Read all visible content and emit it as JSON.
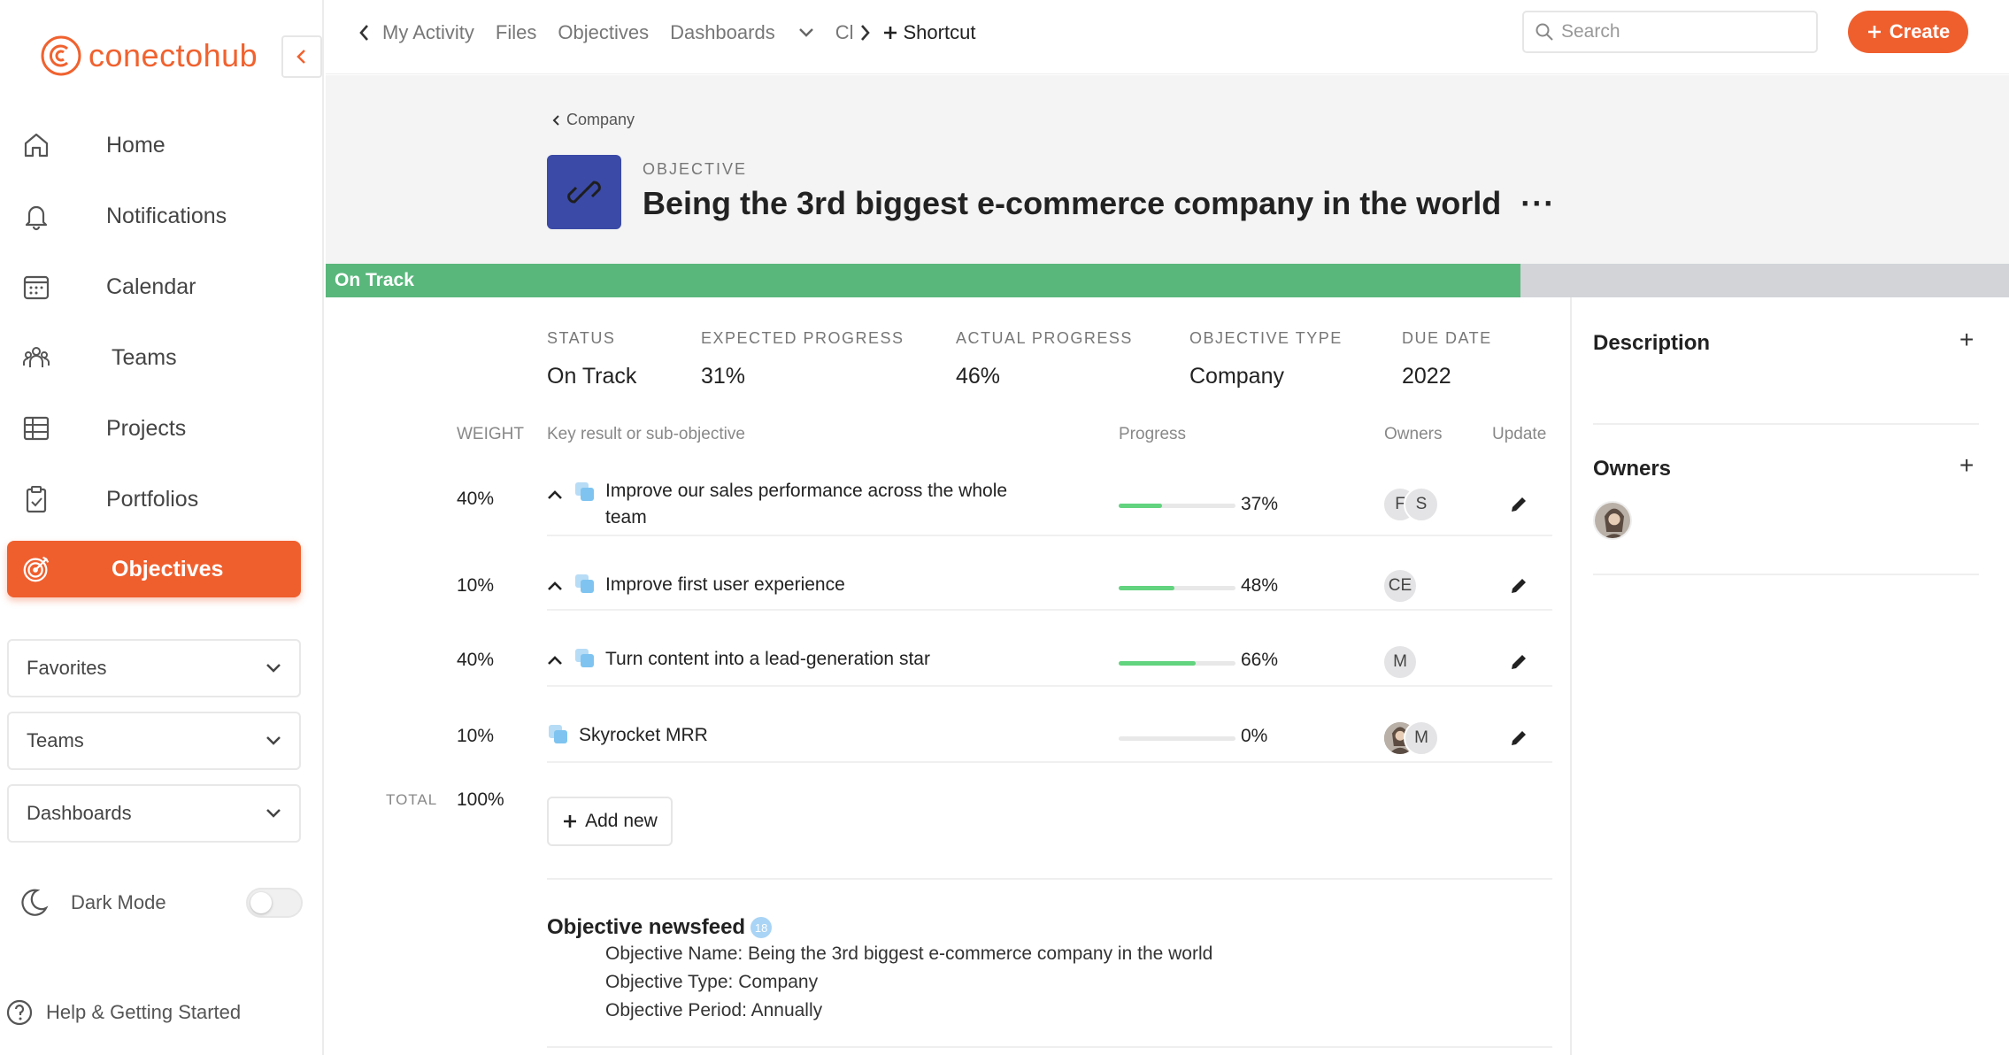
{
  "sidebar": {
    "brand": "conectohub",
    "nav": [
      {
        "label": "Home",
        "icon": "home-icon"
      },
      {
        "label": "Notifications",
        "icon": "bell-icon"
      },
      {
        "label": "Calendar",
        "icon": "calendar-icon"
      },
      {
        "label": "Teams",
        "icon": "teams-icon"
      },
      {
        "label": "Projects",
        "icon": "projects-icon"
      },
      {
        "label": "Portfolios",
        "icon": "portfolio-icon"
      },
      {
        "label": "Objectives",
        "icon": "target-icon",
        "active": true
      }
    ],
    "dropdowns": [
      "Favorites",
      "Teams",
      "Dashboards"
    ],
    "dark_mode_label": "Dark Mode",
    "help_label": "Help & Getting Started"
  },
  "topbar": {
    "nav": [
      "My Activity",
      "Files",
      "Objectives",
      "Dashboards",
      "Cl"
    ],
    "shortcut": "Shortcut",
    "search_placeholder": "Search",
    "create_label": "Create"
  },
  "header": {
    "breadcrumb": "Company",
    "label": "OBJECTIVE",
    "title": "Being the 3rd biggest e-commerce company in the world",
    "more": "···",
    "status_bar_label": "On Track",
    "status_bar_progress": 0.71,
    "accent_color": "#ef5f2e"
  },
  "meta": [
    {
      "key": "STATUS",
      "value": "On Track"
    },
    {
      "key": "EXPECTED PROGRESS",
      "value": "31%"
    },
    {
      "key": "ACTUAL PROGRESS",
      "value": "46%"
    },
    {
      "key": "OBJECTIVE TYPE",
      "value": "Company"
    },
    {
      "key": "DUE DATE",
      "value": "2022"
    }
  ],
  "table": {
    "headers": {
      "weight": "WEIGHT",
      "kr": "Key result or sub-objective",
      "progress": "Progress",
      "owners": "Owners",
      "update": "Update"
    },
    "rows": [
      {
        "weight": "40%",
        "line1": "Improve our sales performance across the whole",
        "line2": "team",
        "progress": 37,
        "pct": "37%",
        "owners": [
          "F",
          "S"
        ]
      },
      {
        "weight": "10%",
        "line1": "Improve first user experience",
        "progress": 48,
        "pct": "48%",
        "owners": [
          "CE"
        ]
      },
      {
        "weight": "40%",
        "line1": "Turn content into a lead-generation star",
        "progress": 66,
        "pct": "66%",
        "owners": [
          "M"
        ]
      },
      {
        "weight": "10%",
        "line1": "Skyrocket MRR",
        "progress": 0,
        "pct": "0%",
        "owners": [
          "",
          "M"
        ]
      }
    ],
    "total_label": "TOTAL",
    "total_value": "100%",
    "add_new": "Add new"
  },
  "newsfeed": {
    "title": "Objective newsfeed",
    "count": "18",
    "lines": [
      "Objective Name: Being the 3rd biggest e-commerce company in the world",
      "Objective Type: Company",
      "Objective Period: Annually"
    ]
  },
  "right_panel": {
    "description": "Description",
    "owners": "Owners",
    "plus": "+"
  }
}
